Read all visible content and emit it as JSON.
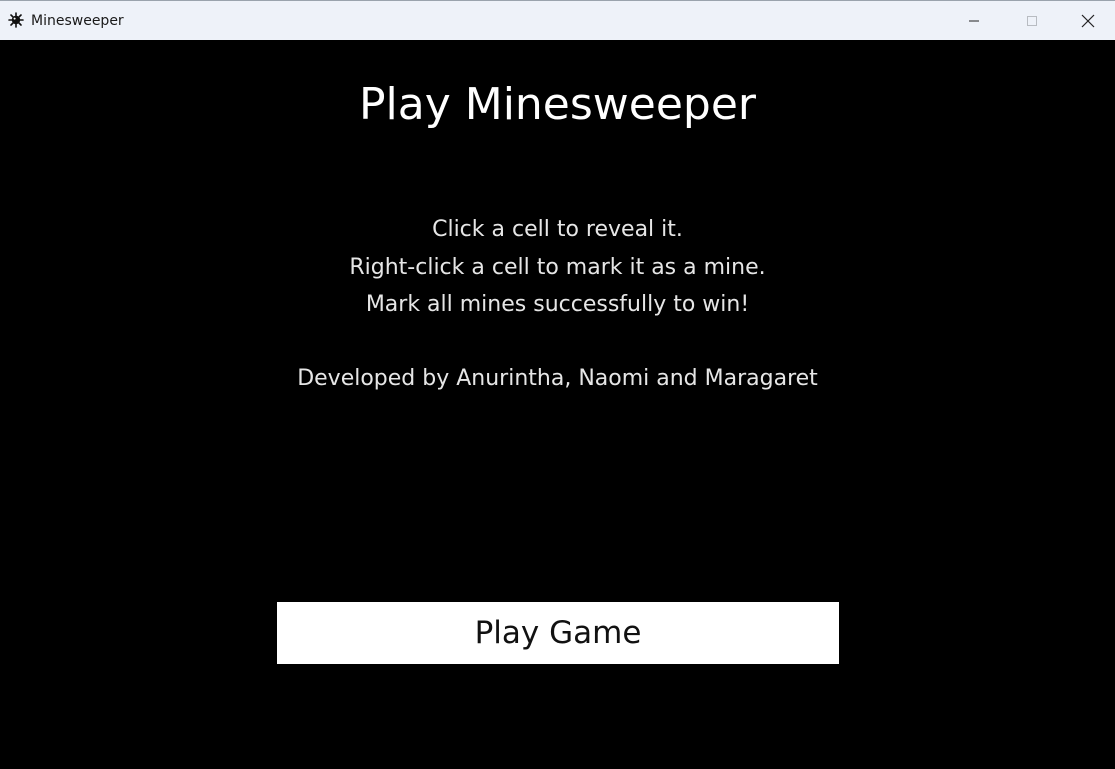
{
  "window": {
    "title": "Minesweeper",
    "icon": "mine-icon",
    "controls": {
      "minimize_icon": "minimize-icon",
      "maximize_icon": "maximize-icon",
      "close_icon": "close-icon"
    }
  },
  "main": {
    "heading": "Play Minesweeper",
    "instructions": [
      "Click a cell to reveal it.",
      "Right-click a cell to mark it as a mine.",
      "Mark all mines successfully to win!"
    ],
    "credits": "Developed by Anurintha, Naomi and Maragaret",
    "play_button_label": "Play Game"
  },
  "colors": {
    "background": "#000000",
    "titlebar": "#eef2f9",
    "text": "#ffffff",
    "button_background": "#ffffff",
    "button_text": "#111111"
  }
}
